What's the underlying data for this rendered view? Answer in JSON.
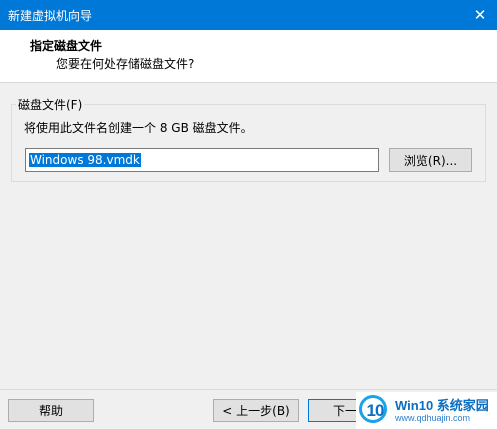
{
  "window": {
    "title": "新建虚拟机向导",
    "close_glyph": "✕"
  },
  "header": {
    "title": "指定磁盘文件",
    "subtitle": "您要在何处存储磁盘文件?"
  },
  "disk_file": {
    "group_label": "磁盘文件(F)",
    "description": "将使用此文件名创建一个 8 GB 磁盘文件。",
    "value": "Windows 98.vmdk",
    "browse_label": "浏览(R)..."
  },
  "footer": {
    "help_label": "帮助",
    "back_label": "< 上一步(B)",
    "next_label": "下一步"
  },
  "watermark": {
    "logo_text": "10",
    "title": "Win10 系统家园",
    "url": "www.qdhuajin.com"
  },
  "colors": {
    "accent": "#0078d7",
    "background": "#f0f0f0"
  }
}
